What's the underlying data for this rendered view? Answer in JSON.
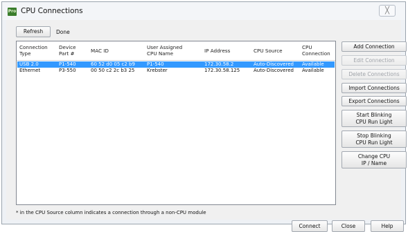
{
  "window": {
    "app_icon_text": "Pro",
    "title": "CPU Connections",
    "close_glyph": "╳"
  },
  "toolbar": {
    "refresh_label": "Refresh",
    "status": "Done"
  },
  "table": {
    "columns": [
      "Connection\nType",
      "Device\nPart #",
      "MAC ID",
      "User Assigned\nCPU Name",
      "IP Address",
      "CPU Source",
      "CPU\nConnection"
    ],
    "rows": [
      {
        "selected": true,
        "cells": [
          "USB 2.0",
          "P1-540",
          "60 52 d0 05 c2 b9",
          "P1-540",
          "172.30.58.2",
          "Auto-Discovered",
          "Available"
        ]
      },
      {
        "selected": false,
        "cells": [
          "Ethernet",
          "P3-550",
          "00 50 c2 2c b3 25",
          "Krebster",
          "172.30.58.125",
          "Auto-Discovered",
          "Available"
        ]
      }
    ],
    "selection_color": "#3399ff"
  },
  "side_buttons": [
    {
      "label": "Add Connection",
      "enabled": true
    },
    {
      "label": "Edit Connection",
      "enabled": false
    },
    {
      "label": "Delete Connections",
      "enabled": false
    },
    {
      "label": "Import Connections",
      "enabled": true
    },
    {
      "label": "Export Connections",
      "enabled": true
    },
    {
      "label": "Start Blinking\nCPU Run Light",
      "enabled": true
    },
    {
      "label": "Stop Blinking\nCPU Run Light",
      "enabled": true
    },
    {
      "label": "Change CPU\nIP / Name",
      "enabled": true
    }
  ],
  "footnote": "* in the CPU Source column indicates a connection through a non-CPU module",
  "footer": {
    "connect_label": "Connect",
    "close_label": "Close",
    "help_label": "Help"
  }
}
